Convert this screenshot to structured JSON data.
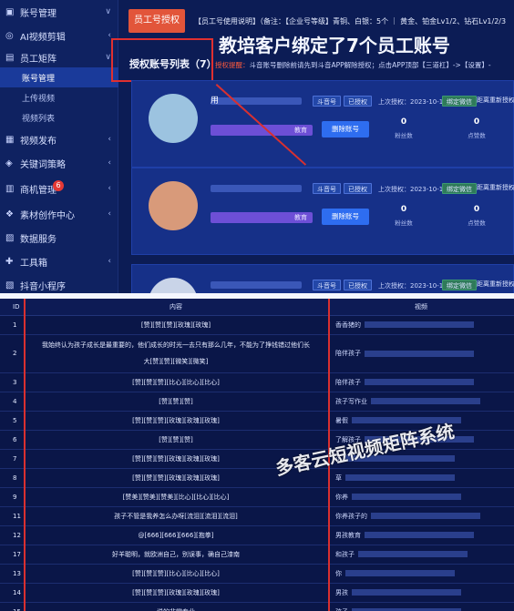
{
  "sidebar": {
    "items": [
      {
        "icon": "▣",
        "label": "账号管理",
        "chevron": "∨"
      },
      {
        "icon": "◎",
        "label": "AI视频剪辑",
        "chevron": "‹"
      },
      {
        "icon": "▤",
        "label": "员工矩阵",
        "chevron": "∨"
      },
      {
        "label": "账号管理",
        "sub": true,
        "active": true
      },
      {
        "label": "上传视频",
        "sub": true
      },
      {
        "label": "视频列表",
        "sub": true
      },
      {
        "icon": "▦",
        "label": "视频发布",
        "chevron": "‹"
      },
      {
        "icon": "◈",
        "label": "关键词策略",
        "chevron": "‹"
      },
      {
        "icon": "▥",
        "label": "商机管理",
        "chevron": "‹",
        "badge": "6"
      },
      {
        "icon": "❖",
        "label": "素材创作中心",
        "chevron": "‹"
      },
      {
        "icon": "▨",
        "label": "数据服务"
      },
      {
        "icon": "✚",
        "label": "工具箱",
        "chevron": "‹"
      },
      {
        "icon": "▧",
        "label": "抖音小程序"
      }
    ]
  },
  "header": {
    "tab_label": "员工号授权",
    "notice": "【员工号使用说明】（备注：【企业号等级】青铜、白银：5个 ｜ 黄金、铂金Lv1/2、钻石Lv1/2/3"
  },
  "callout": "教培客户绑定了7个员工账号",
  "list": {
    "title": "授权账号列表（7）",
    "tip_label": "授权提醒：",
    "tip_text": "斗音账号删除前请先到斗音APP解除授权；点击APP顶部【三道杠】->【设置】-",
    "cards": [
      {
        "name": "用",
        "tag1": "斗音号",
        "tag2": "已授权",
        "auth": "上次授权：2023-10-16",
        "tag3": "绑定微信",
        "desc": "距离重新授权",
        "bar_text": "教育",
        "unbind": "删除账号",
        "fans": "0",
        "fans_label": "粉丝数",
        "likes": "0",
        "likes_label": "点赞数",
        "avatar_color": "#9cc3e0"
      },
      {
        "name": "",
        "tag1": "斗音号",
        "tag2": "已授权",
        "auth": "上次授权：2023-10-16",
        "tag3": "绑定微信",
        "desc": "距离重新授权",
        "bar_text": "教育",
        "unbind": "删除账号",
        "fans": "0",
        "fans_label": "粉丝数",
        "likes": "0",
        "likes_label": "点赞数",
        "avatar_color": "#d89a7a"
      },
      {
        "name": "",
        "tag1": "斗音号",
        "tag2": "已授权",
        "auth": "上次授权：2023-10-16",
        "tag3": "绑定微信",
        "desc": "距离重新授权",
        "bar_text": "",
        "unbind": "",
        "fans": "",
        "fans_label": "",
        "likes": "",
        "likes_label": "",
        "avatar_color": "#c9d4e8"
      }
    ]
  },
  "table": {
    "headers": [
      "ID",
      "内容",
      "视频"
    ],
    "rows": [
      {
        "id": "1",
        "content": "[赞][赞][赞][玫瑰][玫瑰]",
        "video": "香香猪的"
      },
      {
        "id": "2",
        "content": "我始终认为孩子成长是最重要的，他们成长的时光一去只有那么几年，不能为了挣钱错过他们长",
        "content2": "大[赞][赞][微笑][微笑]",
        "video": "陪伴孩子"
      },
      {
        "id": "3",
        "content": "[赞][赞][赞][比心][比心][比心]",
        "video": "陪伴孩子"
      },
      {
        "id": "4",
        "content": "[赞][赞][赞]",
        "video": "孩子写作业"
      },
      {
        "id": "5",
        "content": "[赞][赞][赞][玫瑰][玫瑰][玫瑰]",
        "video": "暑假"
      },
      {
        "id": "6",
        "content": "[赞][赞][赞]",
        "video": "了解孩子"
      },
      {
        "id": "7",
        "content": "[赞][赞][赞][玫瑰][玫瑰][玫瑰]",
        "video": "小"
      },
      {
        "id": "8",
        "content": "[赞][赞][赞][玫瑰][玫瑰][玫瑰]",
        "video": "草"
      },
      {
        "id": "9",
        "content": "[赞美][赞美][赞美][比心][比心][比心]",
        "video": "你养"
      },
      {
        "id": "11",
        "content": "孩子不管是我养怎么办呀[流泪][流泪][流泪]",
        "video": "你养孩子的"
      },
      {
        "id": "12",
        "content": "@[666][666][666][抱拳]",
        "video": "男孩教育"
      },
      {
        "id": "17",
        "content": "好羊聪明，就欧洲自己，别误事，确自己漆南",
        "video": "和孩子"
      },
      {
        "id": "13",
        "content": "[赞][赞][赞][比心][比心][比心]",
        "video": "你"
      },
      {
        "id": "14",
        "content": "[赞][赞][赞][玫瑰][玫瑰][玫瑰]",
        "video": "男孩"
      },
      {
        "id": "15",
        "content": "说的非常专业",
        "video": "孩子"
      }
    ]
  },
  "watermark": "多客云短视频矩阵系统"
}
